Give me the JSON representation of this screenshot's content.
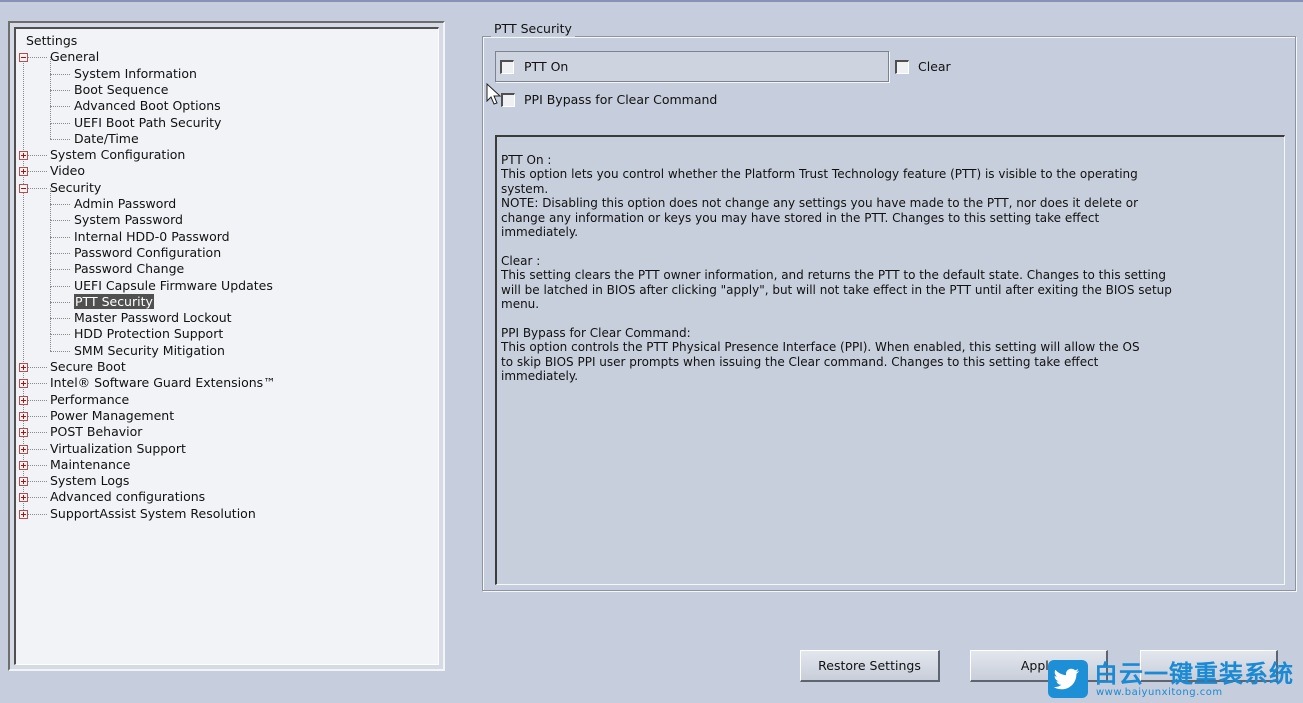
{
  "tree": {
    "items": [
      {
        "label": "Settings",
        "level": 0
      },
      {
        "label": "General",
        "level": 1,
        "expander": "minus"
      },
      {
        "label": "System Information",
        "level": 2
      },
      {
        "label": "Boot Sequence",
        "level": 2
      },
      {
        "label": "Advanced Boot Options",
        "level": 2
      },
      {
        "label": "UEFI Boot Path Security",
        "level": 2
      },
      {
        "label": "Date/Time",
        "level": 2
      },
      {
        "label": "System Configuration",
        "level": 1,
        "expander": "plus"
      },
      {
        "label": "Video",
        "level": 1,
        "expander": "plus"
      },
      {
        "label": "Security",
        "level": 1,
        "expander": "minus"
      },
      {
        "label": "Admin Password",
        "level": 2
      },
      {
        "label": "System Password",
        "level": 2
      },
      {
        "label": "Internal HDD-0 Password",
        "level": 2
      },
      {
        "label": "Password Configuration",
        "level": 2
      },
      {
        "label": "Password Change",
        "level": 2
      },
      {
        "label": "UEFI Capsule Firmware Updates",
        "level": 2
      },
      {
        "label": "PTT Security",
        "level": 2,
        "selected": true
      },
      {
        "label": "Master Password Lockout",
        "level": 2
      },
      {
        "label": "HDD Protection Support",
        "level": 2
      },
      {
        "label": "SMM Security Mitigation",
        "level": 2
      },
      {
        "label": "Secure Boot",
        "level": 1,
        "expander": "plus"
      },
      {
        "label": "Intel® Software Guard Extensions™",
        "level": 1,
        "expander": "plus"
      },
      {
        "label": "Performance",
        "level": 1,
        "expander": "plus"
      },
      {
        "label": "Power Management",
        "level": 1,
        "expander": "plus"
      },
      {
        "label": "POST Behavior",
        "level": 1,
        "expander": "plus"
      },
      {
        "label": "Virtualization Support",
        "level": 1,
        "expander": "plus"
      },
      {
        "label": "Maintenance",
        "level": 1,
        "expander": "plus"
      },
      {
        "label": "System Logs",
        "level": 1,
        "expander": "plus"
      },
      {
        "label": "Advanced configurations",
        "level": 1,
        "expander": "plus"
      },
      {
        "label": "SupportAssist System Resolution",
        "level": 1,
        "expander": "plus"
      }
    ]
  },
  "section": {
    "title": "PTT Security",
    "ptt_on_label": "PTT On",
    "ptt_on_checked": false,
    "clear_label": "Clear",
    "clear_checked": false,
    "ppi_bypass_label": "PPI Bypass for Clear Command",
    "ppi_bypass_checked": false
  },
  "help": {
    "text": "PTT On :\nThis option lets you control whether the Platform Trust Technology feature (PTT) is visible to the operating\nsystem.\nNOTE: Disabling this option does not change any settings you have made to the PTT, nor does it delete or\nchange any information or keys you may have stored in the PTT. Changes to this setting take effect\nimmediately.\n\nClear :\nThis setting clears the PTT owner information, and returns the PTT to the default state. Changes to this setting\nwill be latched in BIOS after clicking \"apply\", but will not take effect in the PTT until after exiting the BIOS setup\nmenu.\n\nPPI Bypass for Clear Command:\nThis option controls the PTT Physical Presence Interface (PPI). When enabled, this setting will allow the OS\nto skip BIOS PPI user prompts when issuing the Clear command. Changes to this setting take effect\nimmediately."
  },
  "buttons": {
    "restore": "Restore Settings",
    "apply": "Apply"
  },
  "watermark": {
    "text": "白云一键重装系统",
    "url": "www.baiyunxitong.com",
    "icon": "twitter-bird-icon",
    "color": "#1a8ad4"
  },
  "colors": {
    "background": "#c6cddc",
    "tree_background": "#f1f3f7",
    "selected_background": "#505050",
    "expander_color": "#b01010"
  }
}
